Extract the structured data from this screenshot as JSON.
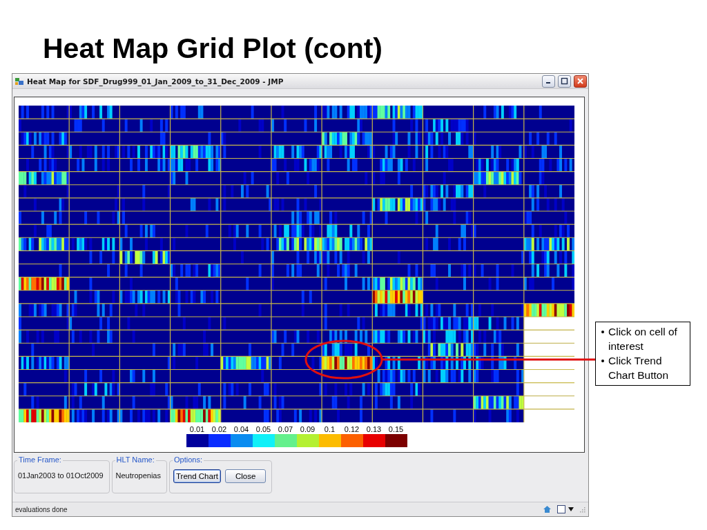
{
  "slide_title": "Heat Map Grid Plot (cont)",
  "window": {
    "title": "Heat Map for SDF_Drug999_01_Jan_2009_to_31_Dec_2009 - JMP"
  },
  "legend": [
    {
      "label": "0.01",
      "color": "#00009c"
    },
    {
      "label": "0.02",
      "color": "#0a2cff"
    },
    {
      "label": "0.04",
      "color": "#0a8cf0"
    },
    {
      "label": "0.05",
      "color": "#10f0f8"
    },
    {
      "label": "0.07",
      "color": "#64f08c"
    },
    {
      "label": "0.09",
      "color": "#b4f032"
    },
    {
      "label": "0.1",
      "color": "#fcbc00"
    },
    {
      "label": "0.12",
      "color": "#fc6000"
    },
    {
      "label": "0.13",
      "color": "#e80000"
    },
    {
      "label": "0.15",
      "color": "#7c0000"
    }
  ],
  "panels": [
    {
      "legend": "Time Frame:",
      "value": "01Jan2003 to 01Oct2009"
    },
    {
      "legend": "HLT Name:",
      "value": "Neutropenias"
    }
  ],
  "options": {
    "legend": "Options:",
    "buttons": [
      {
        "label": "Trend Chart",
        "focused": true
      },
      {
        "label": "Close",
        "focused": false
      }
    ]
  },
  "status_bar": {
    "text": "evaluations done"
  },
  "callout": {
    "bullets": [
      "Click on cell of interest",
      "Click Trend Chart Button"
    ]
  }
}
